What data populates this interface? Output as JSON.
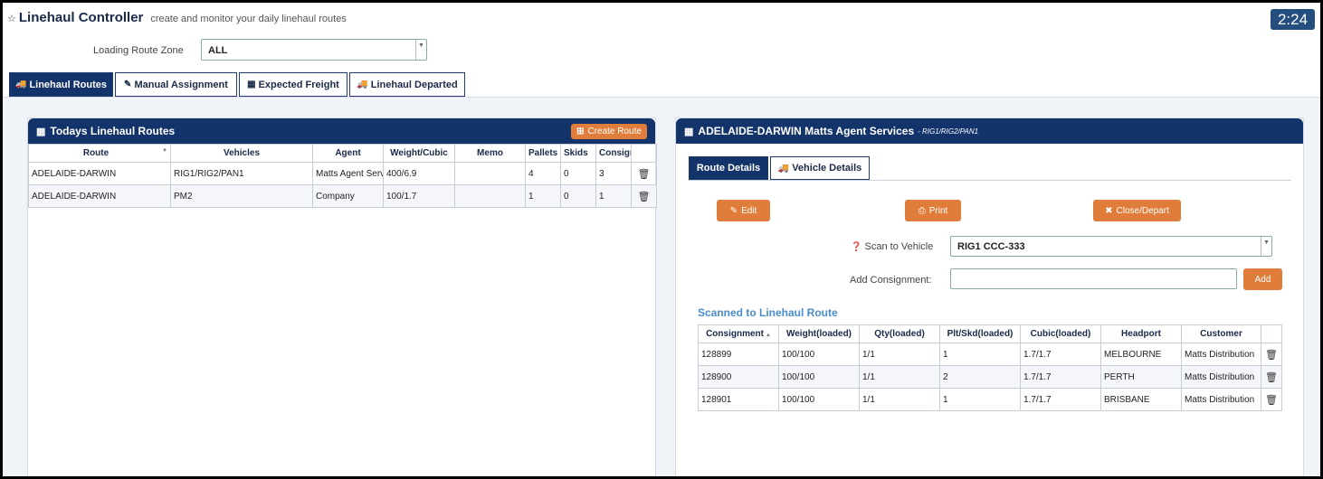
{
  "header": {
    "title": "Linehaul Controller",
    "subtitle": "create and monitor your daily linehaul routes",
    "clock": "2:24"
  },
  "zone": {
    "label": "Loading Route Zone",
    "value": "ALL"
  },
  "tabs": [
    {
      "label": "Linehaul Routes",
      "icon": "truck-icon",
      "glyph": "🚚"
    },
    {
      "label": "Manual Assignment",
      "icon": "edit-icon",
      "glyph": "✎"
    },
    {
      "label": "Expected Freight",
      "icon": "calendar-icon",
      "glyph": "▦"
    },
    {
      "label": "Linehaul Departed",
      "icon": "truck-icon",
      "glyph": "🚚"
    }
  ],
  "routes_panel": {
    "title": "Todays Linehaul Routes",
    "create_button": "Create Route",
    "columns": [
      "Route",
      "Vehicles",
      "Agent",
      "Weight/Cubic",
      "Memo",
      "Pallets",
      "Skids",
      "Consignments"
    ],
    "rows": [
      [
        "ADELAIDE-DARWIN",
        "RIG1/RIG2/PAN1",
        "Matts Agent Services",
        "400/6.9",
        "",
        "4",
        "0",
        "3"
      ],
      [
        "ADELAIDE-DARWIN",
        "PM2",
        "Company",
        "100/1.7",
        "",
        "1",
        "0",
        "1"
      ]
    ]
  },
  "detail_panel": {
    "title": "ADELAIDE-DARWIN Matts Agent Services",
    "subtitle": "- RIG1/RIG2/PAN1",
    "tabs": [
      {
        "label": "Route Details"
      },
      {
        "label": "Vehicle Details"
      }
    ],
    "buttons": {
      "edit": "Edit",
      "print": "Print",
      "close": "Close/Depart"
    },
    "scan_label": "Scan to Vehicle",
    "scan_value": "RIG1 CCC-333",
    "add_consignment_label": "Add Consignment:",
    "add_consignment_value": "",
    "add_button": "Add",
    "scanned_title": "Scanned to Linehaul Route",
    "columns": [
      "Consignment",
      "Weight(loaded)",
      "Qty(loaded)",
      "Plt/Skd(loaded)",
      "Cubic(loaded)",
      "Headport",
      "Customer"
    ],
    "rows": [
      [
        "128899",
        "100/100",
        "1/1",
        "1",
        "1.7/1.7",
        "MELBOURNE",
        "Matts Distribution"
      ],
      [
        "128900",
        "100/100",
        "1/1",
        "2",
        "1.7/1.7",
        "PERTH",
        "Matts Distribution"
      ],
      [
        "128901",
        "100/100",
        "1/1",
        "1",
        "1.7/1.7",
        "BRISBANE",
        "Matts Distribution"
      ]
    ]
  },
  "colors": {
    "navy": "#12346b",
    "orange": "#e07d3a",
    "link_blue": "#4a8cc8",
    "clock_bg": "#234e7e"
  }
}
